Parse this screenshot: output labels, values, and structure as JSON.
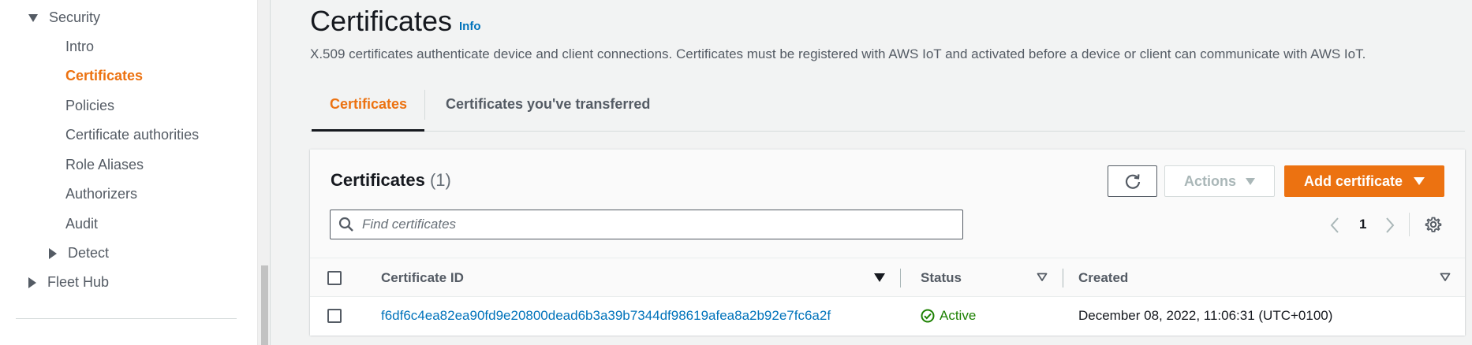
{
  "sidebar": {
    "security_label": "Security",
    "items": [
      {
        "label": "Intro"
      },
      {
        "label": "Certificates"
      },
      {
        "label": "Policies"
      },
      {
        "label": "Certificate authorities"
      },
      {
        "label": "Role Aliases"
      },
      {
        "label": "Authorizers"
      },
      {
        "label": "Audit"
      }
    ],
    "detect_label": "Detect",
    "fleet_hub_label": "Fleet Hub",
    "active_color": "#ec7211"
  },
  "header": {
    "title": "Certificates",
    "info_label": "Info",
    "description": "X.509 certificates authenticate device and client connections. Certificates must be registered with AWS IoT and activated before a device or client can communicate with AWS IoT."
  },
  "tabs": [
    {
      "label": "Certificates"
    },
    {
      "label": "Certificates you've transferred"
    }
  ],
  "card": {
    "title": "Certificates",
    "count": "(1)",
    "refresh_icon": "refresh-icon",
    "actions_label": "Actions",
    "add_label": "Add certificate",
    "search_placeholder": "Find certificates",
    "page_number": "1",
    "accent_color": "#ec7211"
  },
  "table": {
    "columns": [
      "Certificate ID",
      "Status",
      "Created"
    ],
    "rows": [
      {
        "certificate_id": "f6df6c4ea82ea90fd9e20800dead6b3a39b7344df98619afea8a2b92e7fc6a2f",
        "status": "Active",
        "created": "December 08, 2022, 11:06:31 (UTC+0100)"
      }
    ],
    "status_color": "#1d8102"
  }
}
